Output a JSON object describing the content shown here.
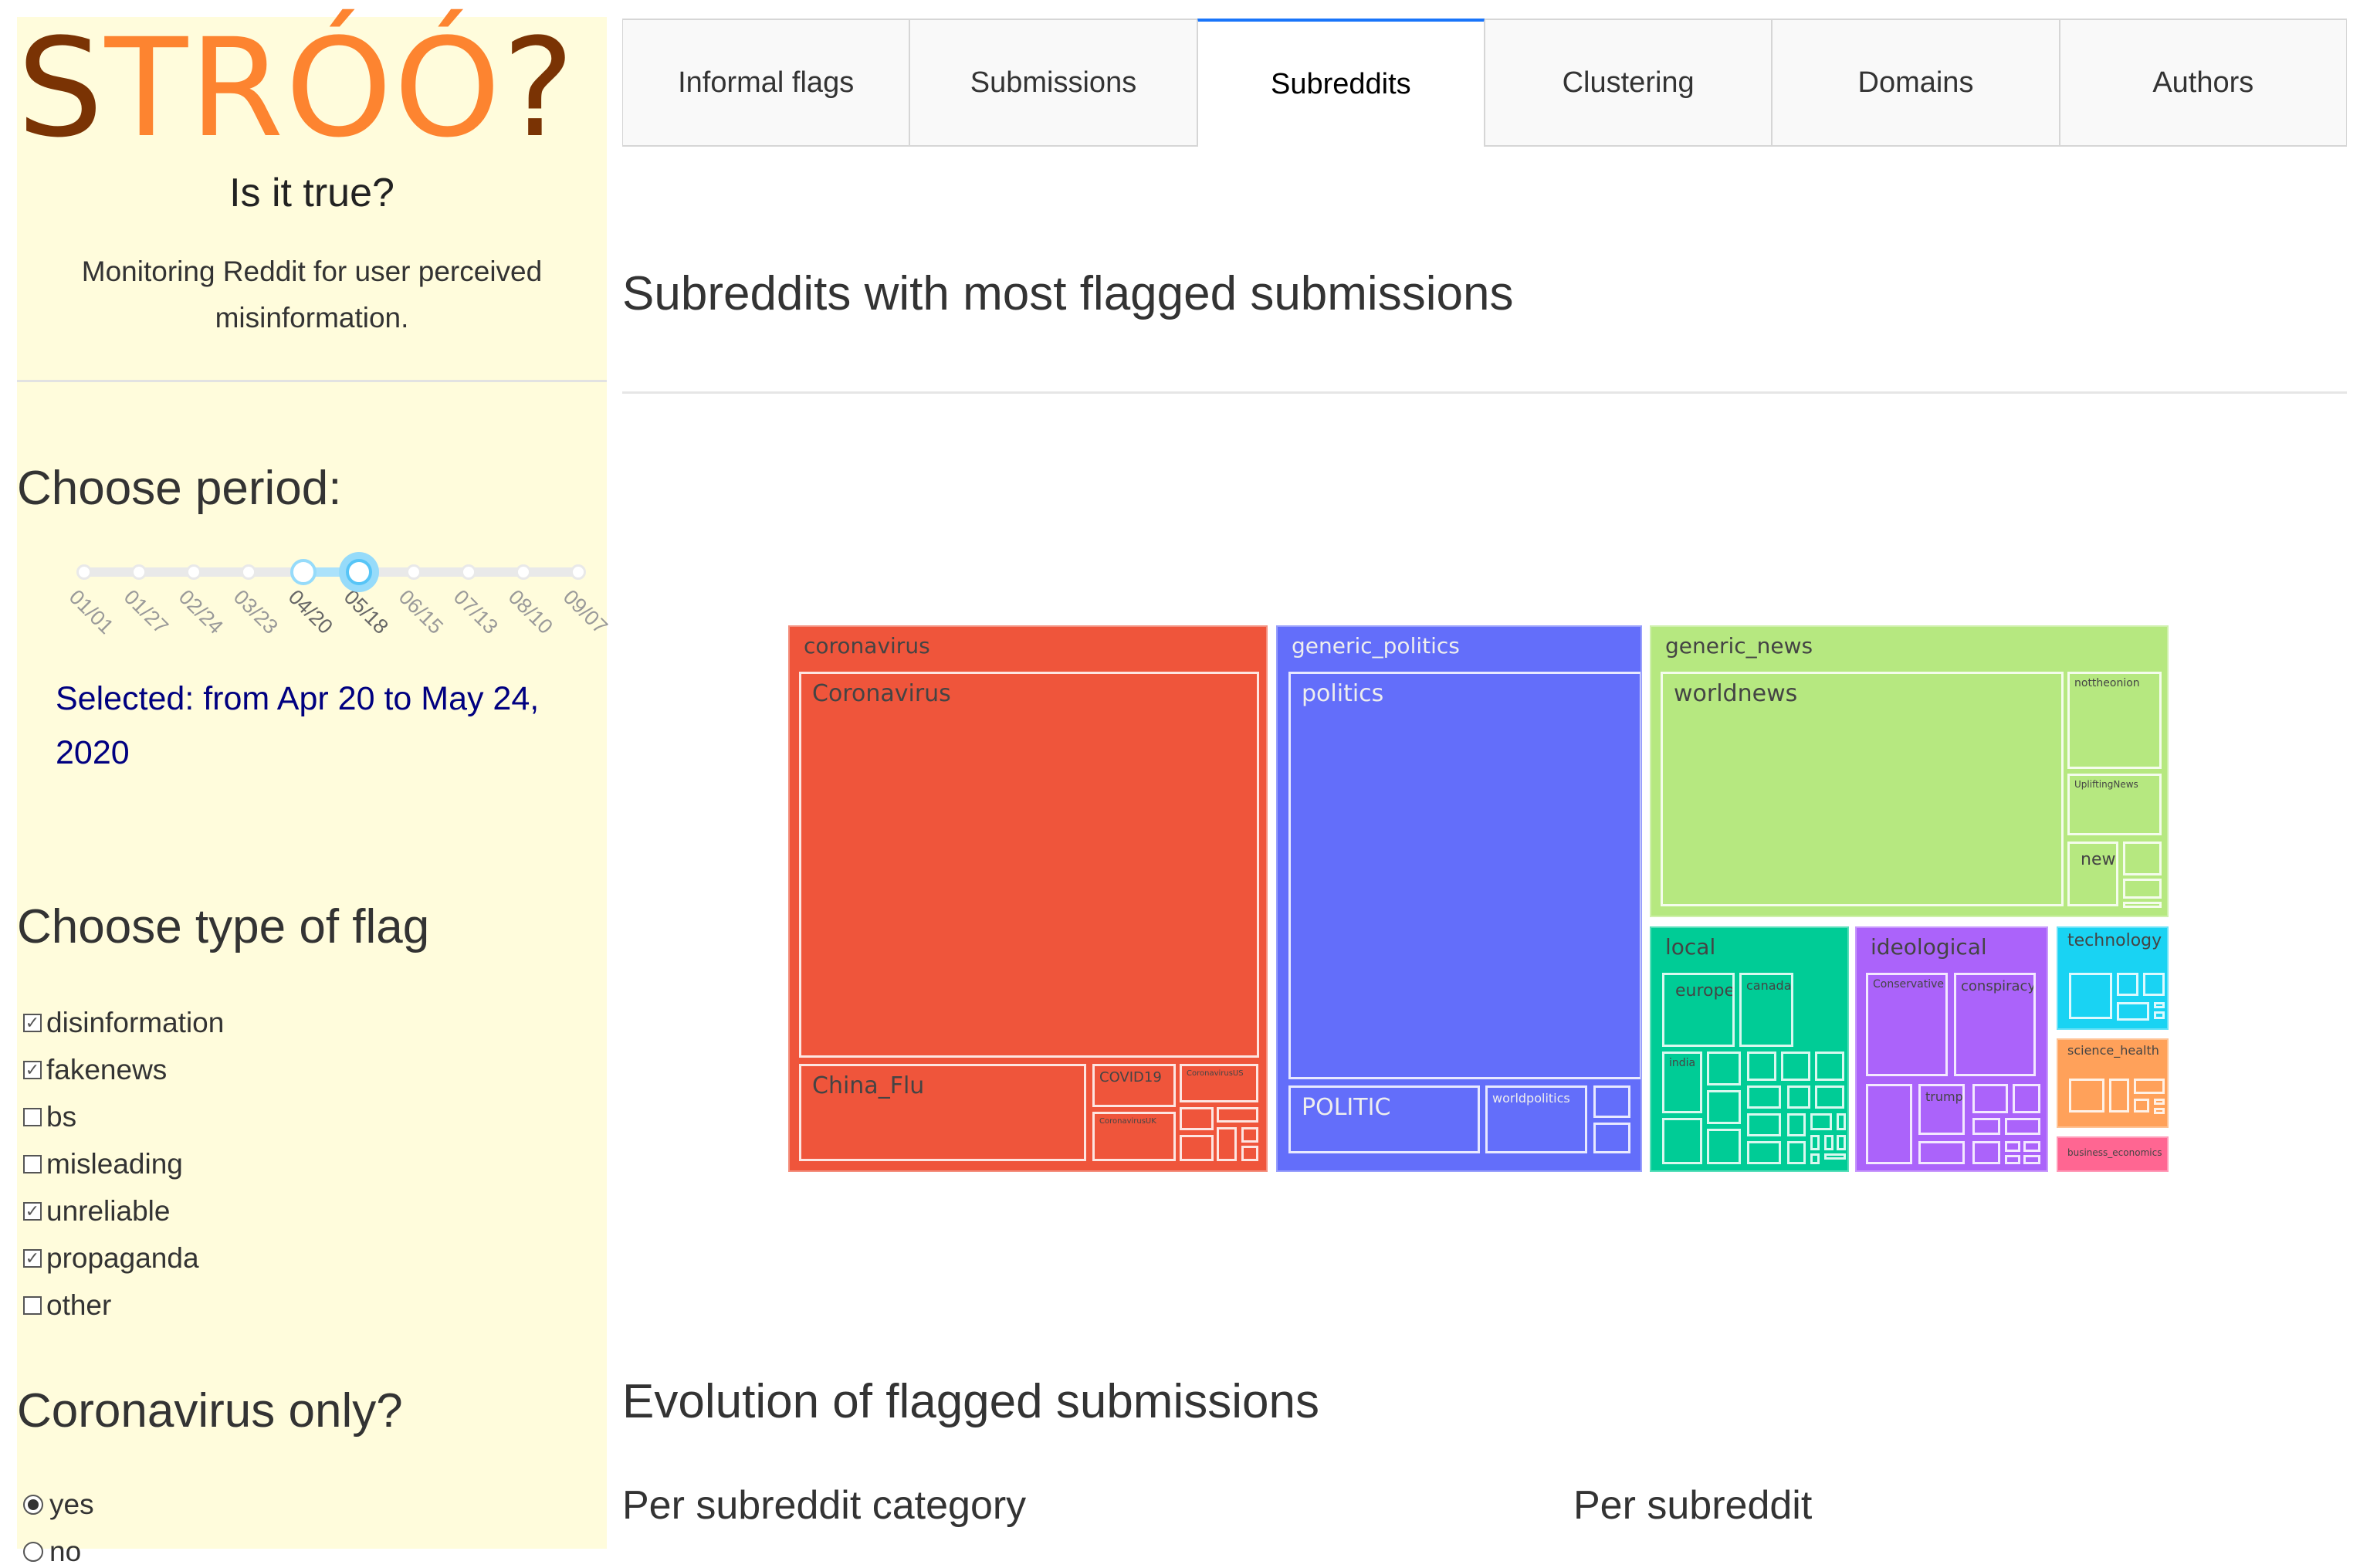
{
  "sidebar": {
    "logo": {
      "parts": [
        "S",
        "TRÓÓ",
        "?"
      ]
    },
    "tagline": "Is it true?",
    "description": "Monitoring Reddit for user perceived misinformation.",
    "period": {
      "heading": "Choose period:",
      "marks": [
        "01/01",
        "01/27",
        "02/24",
        "03/23",
        "04/20",
        "05/18",
        "06/15",
        "07/13",
        "08/10",
        "09/07"
      ],
      "range_start_index": 4,
      "range_end_index": 5,
      "selected_text": "Selected: from Apr 20 to May 24, 2020"
    },
    "flag_type": {
      "heading": "Choose type of flag",
      "options": [
        {
          "label": "disinformation",
          "checked": true
        },
        {
          "label": "fakenews",
          "checked": true
        },
        {
          "label": "bs",
          "checked": false
        },
        {
          "label": "misleading",
          "checked": false
        },
        {
          "label": "unreliable",
          "checked": true
        },
        {
          "label": "propaganda",
          "checked": true
        },
        {
          "label": "other",
          "checked": false
        }
      ]
    },
    "corona": {
      "heading": "Coronavirus only?",
      "options": [
        {
          "label": "yes",
          "selected": true
        },
        {
          "label": "no",
          "selected": false
        }
      ]
    }
  },
  "tabs": [
    {
      "label": "Informal flags",
      "active": false
    },
    {
      "label": "Submissions",
      "active": false
    },
    {
      "label": "Subreddits",
      "active": true
    },
    {
      "label": "Clustering",
      "active": false
    },
    {
      "label": "Domains",
      "active": false
    },
    {
      "label": "Authors",
      "active": false
    }
  ],
  "main": {
    "title": "Subreddits with most flagged submissions",
    "evolution_title": "Evolution of flagged submissions",
    "per_category_title": "Per subreddit category",
    "per_subreddit_title": "Per subreddit"
  },
  "colors": {
    "accent": "#1975fa",
    "sidebar_bg": "#fffcdc",
    "selected_text": "#000080"
  },
  "chart_data": {
    "type": "treemap",
    "title": "Subreddits with most flagged submissions",
    "categories": [
      {
        "name": "coronavirus",
        "color": "#ef553b",
        "label_color": "#444444",
        "children": [
          "Coronavirus",
          "China_Flu",
          "COVID19",
          "CoronavirusUS",
          "CoronavirusUK"
        ]
      },
      {
        "name": "generic_politics",
        "color": "#636efa",
        "label_color": "#eeeeee",
        "children": [
          "politics",
          "POLITIC",
          "worldpolitics"
        ]
      },
      {
        "name": "generic_news",
        "color": "#b6e880",
        "label_color": "#444444",
        "children": [
          "worldnews",
          "nottheonion",
          "UpliftingNews",
          "news"
        ]
      },
      {
        "name": "local",
        "color": "#00cc96",
        "label_color": "#444444",
        "children": [
          "europe",
          "canada",
          "india"
        ]
      },
      {
        "name": "ideological",
        "color": "#ab63fa",
        "label_color": "#444444",
        "children": [
          "Conservative",
          "conspiracy",
          "trump"
        ]
      },
      {
        "name": "technology",
        "color": "#19d3f3",
        "label_color": "#444444",
        "children": []
      },
      {
        "name": "science_health",
        "color": "#ffa15a",
        "label_color": "#444444",
        "children": []
      },
      {
        "name": "business_economics",
        "color": "#ff6692",
        "label_color": "#444444",
        "children": []
      }
    ]
  }
}
